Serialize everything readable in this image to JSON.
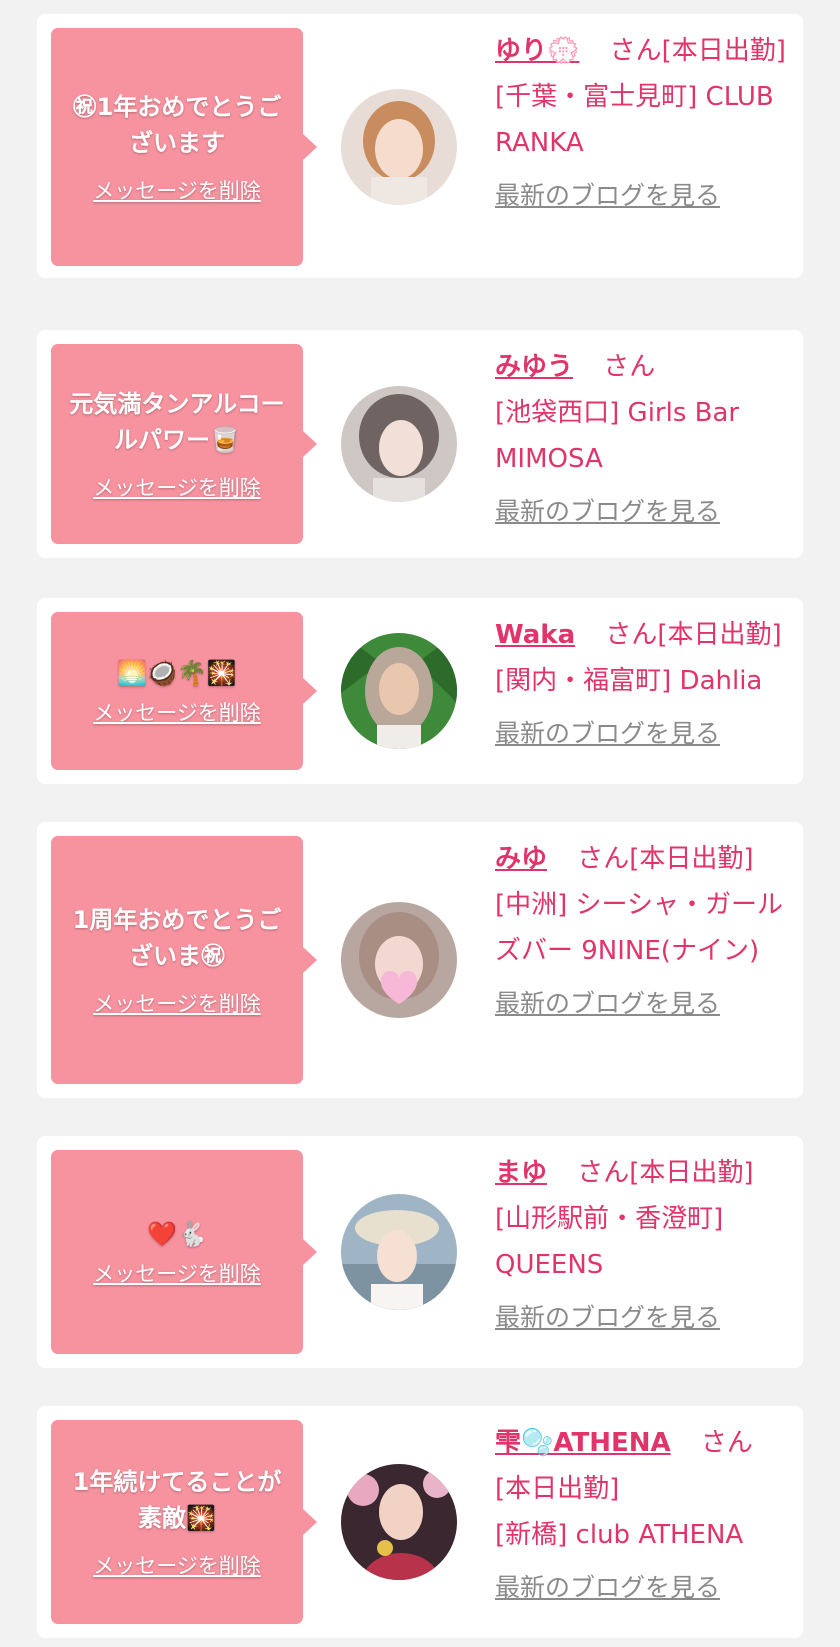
{
  "delete_label": "メッセージを削除",
  "blog_label": "最新のブログを見る",
  "cards": [
    {
      "message": "㊗1年おめでとうございます",
      "name": "ゆり",
      "name_emoji": "💮",
      "suffix": "さん[本日出勤]",
      "shop": "[千葉・富士見町] CLUB RANKA"
    },
    {
      "message": "元気満タンアルコールパワー🥃",
      "name": "みゆう",
      "name_emoji": "",
      "suffix": "さん",
      "shop": "[池袋西口] Girls Bar MIMOSA"
    },
    {
      "message": "🌅🥥🌴🎇",
      "name": "Waka",
      "name_emoji": "",
      "suffix": "さん[本日出勤]",
      "shop": "[関内・福富町] Dahlia"
    },
    {
      "message": "1周年おめでとうございま㊗",
      "name": "みゆ",
      "name_emoji": "",
      "suffix": "さん[本日出勤]",
      "shop": "[中洲] シーシャ・ガールズバー 9NINE(ナイン)"
    },
    {
      "message": "❤️🐇",
      "name": "まゆ",
      "name_emoji": "",
      "suffix": "さん[本日出勤]",
      "shop": "[山形駅前・香澄町] QUEENS"
    },
    {
      "message": "1年続けてることが素敵🎇",
      "name": "雫🫧ATHENA",
      "name_emoji": "",
      "suffix": "さん[本日出勤]",
      "shop": "[新橋] club ATHENA"
    }
  ],
  "colors": {
    "bubble": "#f7929f",
    "name": "#e0346a",
    "blog_link": "#8a8a8a",
    "background": "#f2f2f2"
  },
  "avatar_icons": [
    "avatar-yuri",
    "avatar-miyuu",
    "avatar-waka",
    "avatar-miyu",
    "avatar-mayu",
    "avatar-shizuku"
  ]
}
